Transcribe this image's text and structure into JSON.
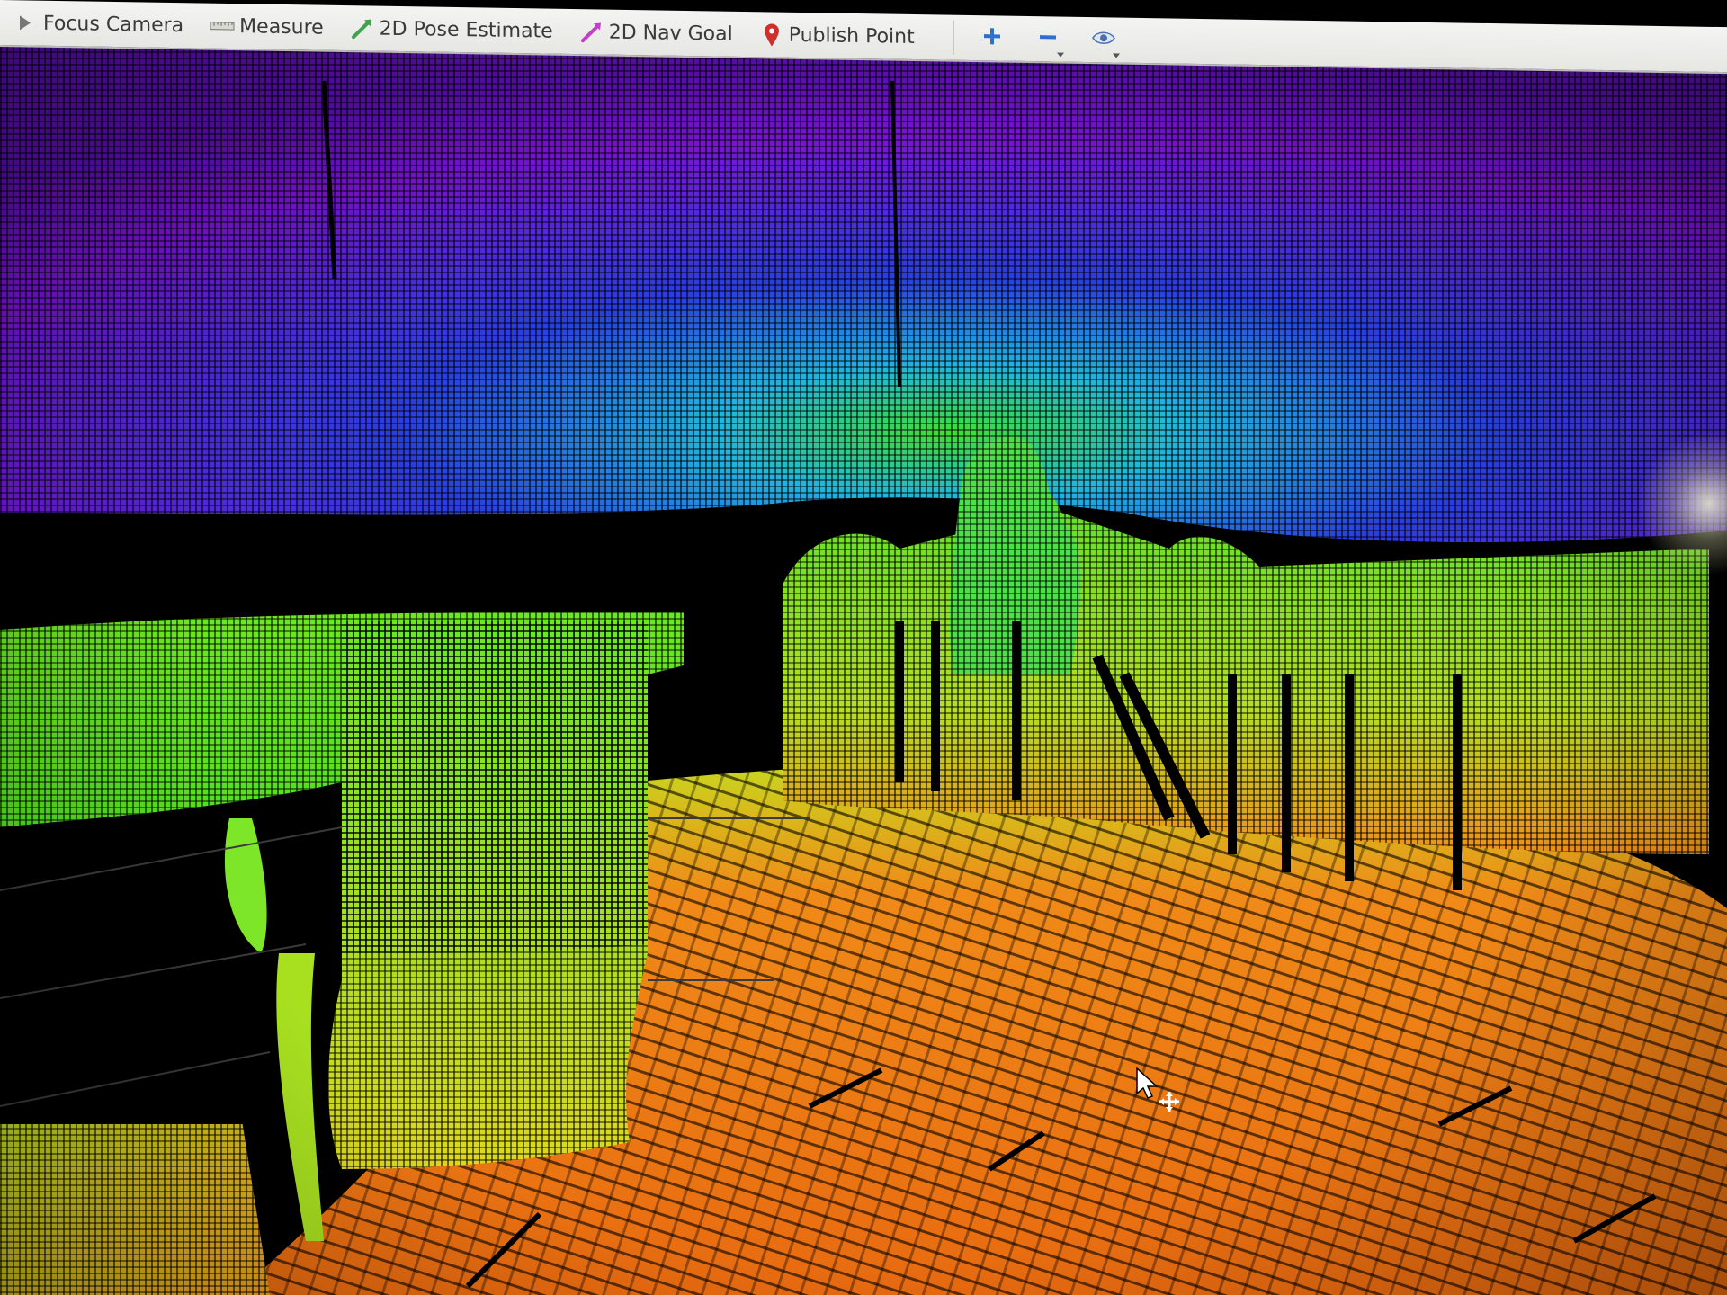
{
  "toolbar": {
    "tools": [
      {
        "label": "Focus Camera",
        "icon": "focus-camera-icon"
      },
      {
        "label": "Measure",
        "icon": "ruler-icon"
      },
      {
        "label": "2D Pose Estimate",
        "icon": "pose-arrow-icon",
        "color": "#3fa34d"
      },
      {
        "label": "2D Nav Goal",
        "icon": "nav-arrow-icon",
        "color": "#c040c8"
      },
      {
        "label": "Publish Point",
        "icon": "map-pin-icon",
        "color": "#d0302a"
      }
    ],
    "icon_buttons": [
      {
        "icon": "plus-icon",
        "color": "#2f6fd0"
      },
      {
        "icon": "minus-icon",
        "color": "#2f6fd0"
      },
      {
        "icon": "eye-icon",
        "color": "#4a6fb0"
      }
    ]
  },
  "viewport": {
    "content": "point-cloud",
    "colormap": [
      "#7a14d8",
      "#2a3ee0",
      "#1fb6e0",
      "#3fe030",
      "#d8e020",
      "#f07a14"
    ]
  }
}
